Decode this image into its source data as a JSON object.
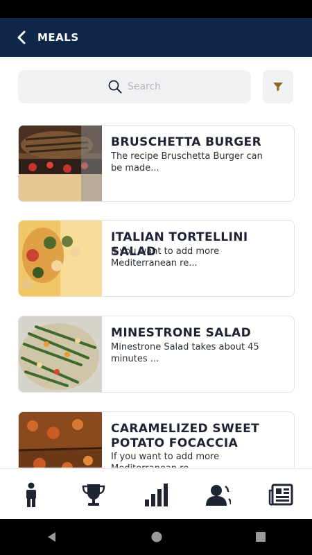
{
  "header": {
    "title": "MEALS"
  },
  "search": {
    "placeholder": "Search"
  },
  "meals": [
    {
      "title": "BRUSCHETTA BURGER",
      "desc": "The recipe Bruschetta Burger can be made..."
    },
    {
      "title": "ITALIAN TORTELLINI SALAD",
      "desc": "If you want to add more Mediterranean re..."
    },
    {
      "title": "MINESTRONE SALAD",
      "desc": "Minestrone Salad takes about 45 minutes ..."
    },
    {
      "title": "CARAMELIZED SWEET POTATO FOCACCIA",
      "desc": "If you want to add more Mediterranean re..."
    }
  ],
  "nav": [
    "person-icon",
    "trophy-icon",
    "stats-icon",
    "profile-icon",
    "news-icon"
  ],
  "colors": {
    "app_bar": "#0f2748",
    "filter_icon": "#8a6a1c",
    "nav_icon": "#1f2533"
  }
}
